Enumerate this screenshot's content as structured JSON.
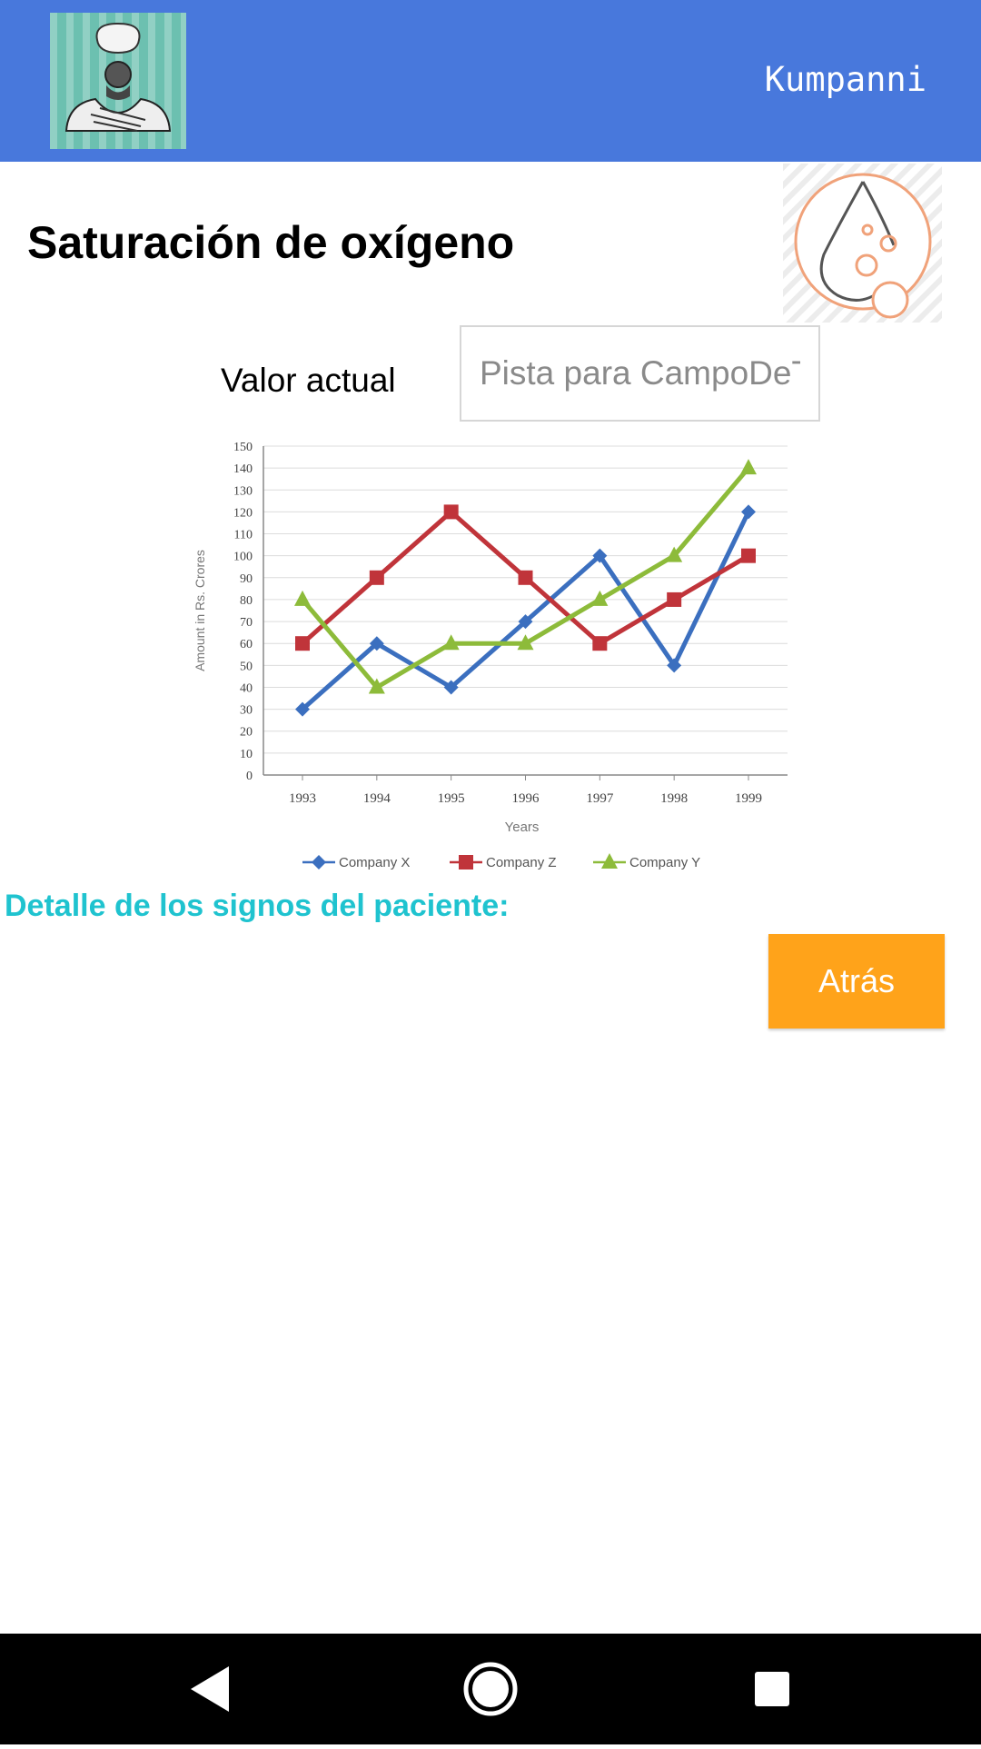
{
  "appbar": {
    "title": "Kumpanni"
  },
  "page": {
    "title": "Saturación de oxígeno"
  },
  "current_value": {
    "label": "Valor actual",
    "placeholder": "Pista para CampoDeTe"
  },
  "details": {
    "label": "Detalle de los signos del paciente:"
  },
  "actions": {
    "back_label": "Atrás"
  },
  "colors": {
    "appbar": "#4878dc",
    "accent_text": "#1fc3cf",
    "back_button": "#ffa31a"
  },
  "icons": [
    "avatar-person-icon",
    "oxygen-drop-icon",
    "nav-back-icon",
    "nav-home-icon",
    "nav-recents-icon"
  ],
  "chart_data": {
    "type": "line",
    "x": [
      "1993",
      "1994",
      "1995",
      "1996",
      "1997",
      "1998",
      "1999"
    ],
    "series": [
      {
        "name": "Company X",
        "values": [
          30,
          60,
          40,
          70,
          100,
          50,
          120
        ],
        "color": "#3b6fbf",
        "marker": "diamond"
      },
      {
        "name": "Company Z",
        "values": [
          60,
          90,
          120,
          90,
          60,
          80,
          100
        ],
        "color": "#c0343a",
        "marker": "square"
      },
      {
        "name": "Company Y",
        "values": [
          80,
          40,
          60,
          60,
          80,
          100,
          140
        ],
        "color": "#8dbb3a",
        "marker": "triangle"
      }
    ],
    "xlabel": "Years",
    "ylabel": "Amount in Rs. Crores",
    "ylim": [
      0,
      150
    ],
    "yticks": [
      "0",
      "10",
      "20",
      "30",
      "40",
      "50",
      "60",
      "70",
      "80",
      "90",
      "100",
      "110",
      "120",
      "130",
      "140",
      "150"
    ],
    "grid": true,
    "legend": "bottom"
  }
}
